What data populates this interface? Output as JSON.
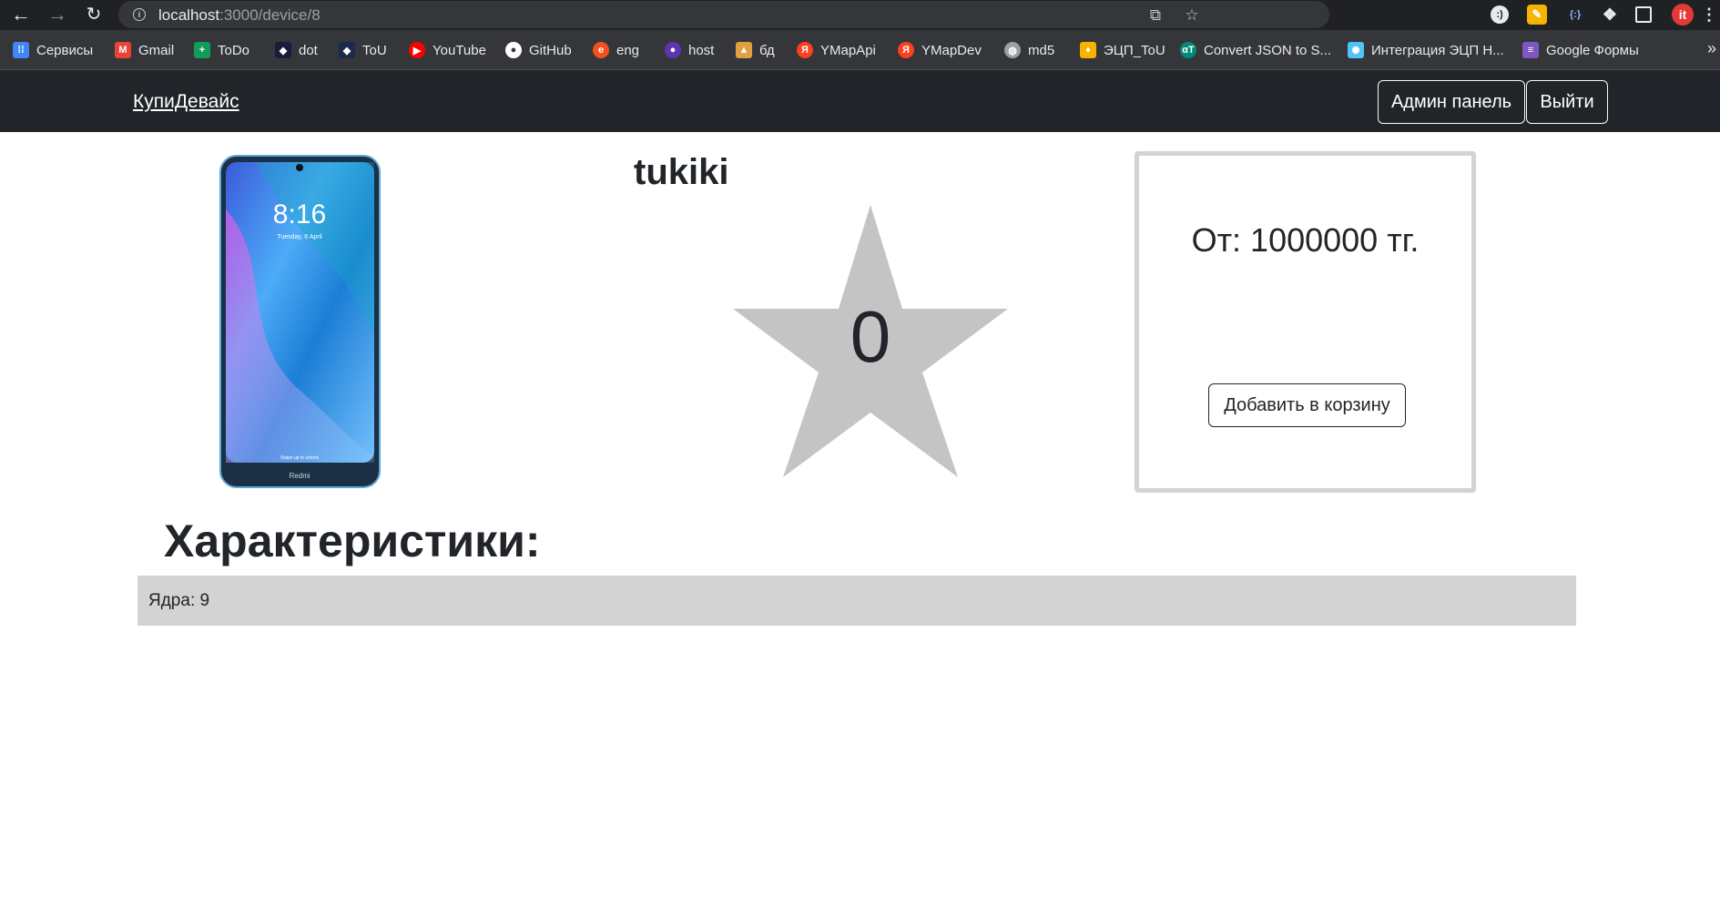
{
  "browser": {
    "url_host": "localhost",
    "url_path": ":3000/device/8",
    "icons": [
      "back-arrow",
      "forward-arrow",
      "reload",
      "info",
      "share",
      "star",
      "extensions",
      "side-panel",
      "menu"
    ],
    "bookmarks": [
      {
        "label": "Сервисы",
        "icon": "apps-grid",
        "color": "#4285f4"
      },
      {
        "label": "Gmail",
        "icon": "gmail",
        "color": "#ea4335"
      },
      {
        "label": "ToDo",
        "icon": "todo-plus",
        "color": "#0f9d58"
      },
      {
        "label": "dot",
        "icon": "dot-logo",
        "color": "#1a1a3a"
      },
      {
        "label": "ToU",
        "icon": "tou-logo",
        "color": "#1a2a4a"
      },
      {
        "label": "YouTube",
        "icon": "youtube",
        "color": "#ff0000"
      },
      {
        "label": "GitHub",
        "icon": "github",
        "color": "#ffffff"
      },
      {
        "label": "eng",
        "icon": "eng-logo",
        "color": "#f4511e"
      },
      {
        "label": "host",
        "icon": "host-logo",
        "color": "#5e35b1"
      },
      {
        "label": "бд",
        "icon": "db-logo",
        "color": "#e0a040"
      },
      {
        "label": "YMapApi",
        "icon": "yandex",
        "color": "#fc3f1d"
      },
      {
        "label": "YMapDev",
        "icon": "yandex",
        "color": "#fc3f1d"
      },
      {
        "label": "md5",
        "icon": "globe",
        "color": "#9aa0a6"
      },
      {
        "label": "ЭЦП_ToU",
        "icon": "ecp-logo",
        "color": "#f4b400"
      },
      {
        "label": "Convert JSON to S...",
        "icon": "convert-logo",
        "color": "#00897b"
      },
      {
        "label": "Интеграция ЭЦП Н...",
        "icon": "integration-logo",
        "color": "#4fc3f7"
      },
      {
        "label": "Google Формы",
        "icon": "google-forms",
        "color": "#7e57c2"
      }
    ],
    "more": "»"
  },
  "navbar": {
    "brand": "КупиДевайс",
    "admin_button": "Админ панель",
    "logout_button": "Выйти"
  },
  "device": {
    "name": "tukiki",
    "rating": "0",
    "price_text": "От: 1000000 тг.",
    "add_to_cart": "Добавить в корзину",
    "phone_screen_time": "8:16",
    "phone_screen_date": "Tuesday, 6 April",
    "phone_brand": "Redmi",
    "phone_unlock_hint": "Swipe up to unlock"
  },
  "specs": {
    "title": "Характеристики:",
    "items": [
      {
        "text": "Ядра: 9"
      }
    ]
  },
  "colors": {
    "navbar_bg": "#212529",
    "star": "#c4c4c4",
    "card_border": "#d3d3d3",
    "spec_row_bg": "#d3d3d3"
  }
}
